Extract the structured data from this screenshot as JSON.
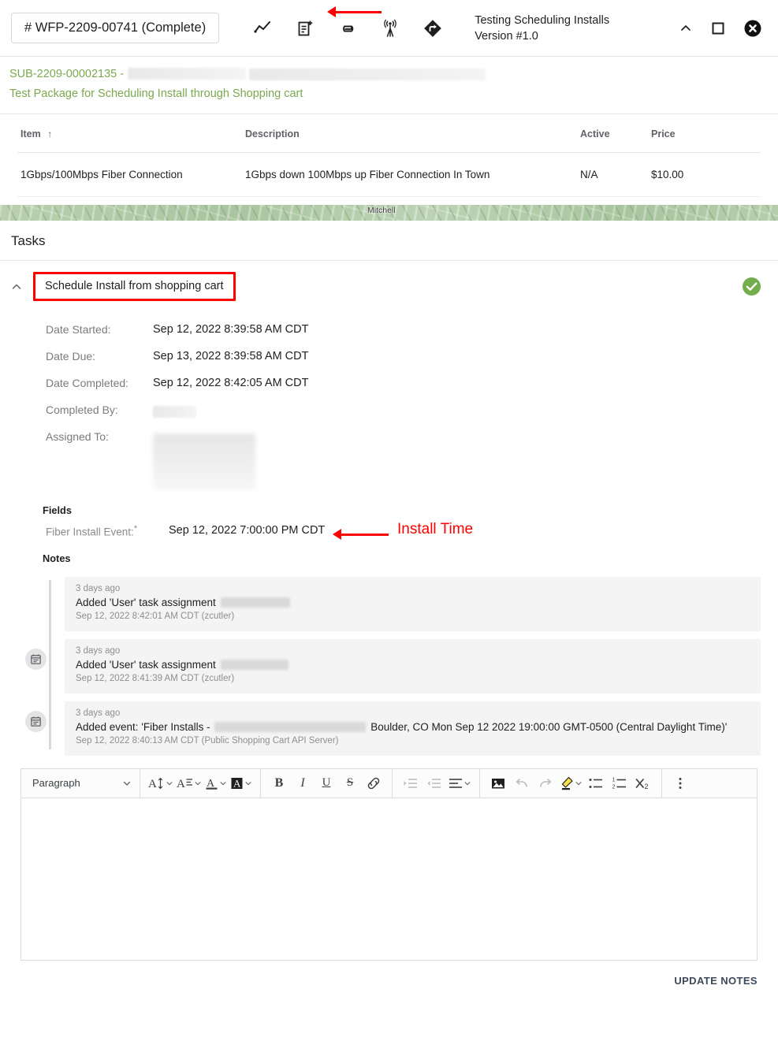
{
  "header": {
    "wfp_chip": "# WFP-2209-00741 (Complete)",
    "title": "Testing Scheduling Installs Version #1.0",
    "icons": [
      {
        "name": "activity-chart-icon",
        "label": "Activity"
      },
      {
        "name": "add-note-icon",
        "label": "Add Note"
      },
      {
        "name": "attachment-icon",
        "label": "Attachments"
      },
      {
        "name": "signal-tower-icon",
        "label": "Signal"
      },
      {
        "name": "directions-icon",
        "label": "Directions"
      }
    ],
    "window_controls": [
      {
        "name": "collapse-icon",
        "label": "Collapse"
      },
      {
        "name": "maximize-icon",
        "label": "Maximize"
      },
      {
        "name": "close-icon",
        "label": "Close"
      }
    ]
  },
  "subheader": {
    "subscription_link": "SUB-2209-00002135 -",
    "package_link": "Test Package for Scheduling Install through Shopping cart",
    "link_color": "#7aa84f"
  },
  "items_table": {
    "columns": [
      "Item",
      "Description",
      "Active",
      "Price"
    ],
    "sort_column": "Item",
    "sort_direction": "asc",
    "sort_glyph": "↑",
    "rows": [
      {
        "item": "1Gbps/100Mbps Fiber Connection",
        "description": "1Gbps down 100Mbps up Fiber Connection In Town",
        "active": "N/A",
        "price": "$10.00"
      }
    ]
  },
  "map": {
    "label": "Mitchell"
  },
  "tasks": {
    "section_title": "Tasks",
    "task_name": "Schedule Install from shopping cart",
    "collapse_glyph": "⌃",
    "status": "complete",
    "status_color": "#74ad4c",
    "highlight_color": "#ff0000",
    "details": [
      {
        "label": "Date Started:",
        "value": "Sep 12, 2022 8:39:58 AM CDT"
      },
      {
        "label": "Date Due:",
        "value": "Sep 13, 2022 8:39:58 AM CDT"
      },
      {
        "label": "Date Completed:",
        "value": "Sep 12, 2022 8:42:05 AM CDT"
      },
      {
        "label": "Completed By:",
        "value": ""
      },
      {
        "label": "Assigned To:",
        "value": ""
      }
    ]
  },
  "fields": {
    "section_title": "Fields",
    "fiber_label": "Fiber Install Event:",
    "required_marker": "*",
    "fiber_value": "Sep 12, 2022 7:00:00 PM CDT",
    "annotation": "Install Time"
  },
  "notes": {
    "section_title": "Notes",
    "entries": [
      {
        "ago": "3 days ago",
        "body_prefix": "Added 'User' task assignment",
        "body_suffix": "",
        "meta": "Sep 12, 2022 8:42:01 AM CDT (zcutler)",
        "icon": "calendar-note-icon",
        "show_icon": false
      },
      {
        "ago": "3 days ago",
        "body_prefix": "Added 'User' task assignment",
        "body_suffix": "",
        "meta": "Sep 12, 2022 8:41:39 AM CDT (zcutler)",
        "icon": "calendar-note-icon",
        "show_icon": true
      },
      {
        "ago": "3 days ago",
        "body_prefix": "Added event: 'Fiber Installs -",
        "body_suffix": "Boulder, CO Mon Sep 12 2022 19:00:00 GMT-0500 (Central Daylight Time)'",
        "meta": "Sep 12, 2022 8:40:13 AM CDT (Public Shopping Cart API Server)",
        "icon": "calendar-note-icon",
        "show_icon": true
      }
    ]
  },
  "editor": {
    "paragraph_select": "Paragraph",
    "caret_glyph": "⌄",
    "buttons": [
      {
        "name": "font-size-dropdown",
        "label": "Font size"
      },
      {
        "name": "line-height-dropdown",
        "label": "Line height"
      },
      {
        "name": "text-color-dropdown",
        "label": "Text color"
      },
      {
        "name": "background-color-dropdown",
        "label": "Background color"
      },
      {
        "name": "bold-button",
        "label": "B"
      },
      {
        "name": "italic-button",
        "label": "I"
      },
      {
        "name": "underline-button",
        "label": "U"
      },
      {
        "name": "strikethrough-button",
        "label": "S"
      },
      {
        "name": "link-button",
        "label": "Link"
      },
      {
        "name": "indent-increase-button",
        "label": "Indent"
      },
      {
        "name": "indent-decrease-button",
        "label": "Outdent"
      },
      {
        "name": "align-dropdown",
        "label": "Align"
      },
      {
        "name": "insert-image-button",
        "label": "Image"
      },
      {
        "name": "undo-button",
        "label": "Undo"
      },
      {
        "name": "redo-button",
        "label": "Redo"
      },
      {
        "name": "highlight-dropdown",
        "label": "Highlight"
      },
      {
        "name": "bulleted-list-button",
        "label": "Bulleted list"
      },
      {
        "name": "numbered-list-button",
        "label": "Numbered list"
      },
      {
        "name": "clear-formatting-button",
        "label": "Clear formatting"
      },
      {
        "name": "more-options-button",
        "label": "More"
      }
    ],
    "content": "",
    "placeholder": "",
    "update_button": "UPDATE NOTES"
  }
}
